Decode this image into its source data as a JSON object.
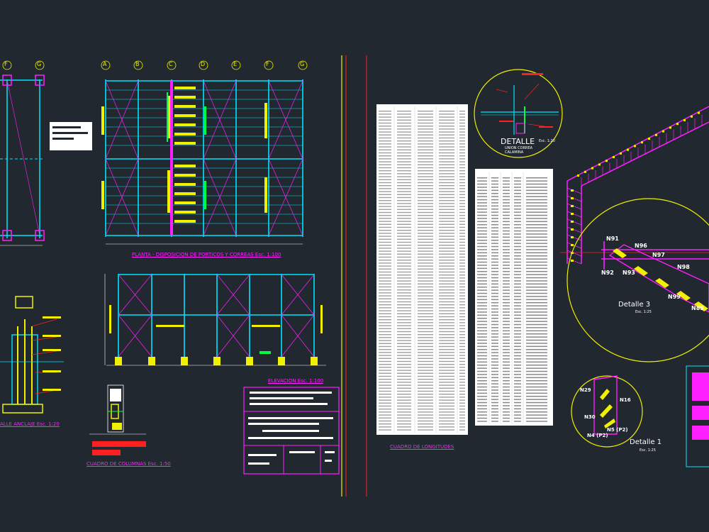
{
  "drawing": {
    "grid_labels_top": [
      "A",
      "B",
      "C",
      "D",
      "E",
      "F",
      "G"
    ],
    "grid_labels_left": [
      "F",
      "G"
    ],
    "plan_title": "PLANTA - DISPOSICION DE PORTICOS Y CORREAS   Esc. 1:100",
    "elevation_title": "ELEVACION    Esc. 1:100",
    "anchor_title": "ALLE ANCLAJE   Esc. 1:20",
    "columns_title": "CUADRO DE COLUMNAS   Esc. 1:50",
    "lengths_title": "CUADRO DE LONGITUDES",
    "detail_top": {
      "title": "DETALLE",
      "scale": "Esc. 1:20",
      "sub1": "UNION CORREA",
      "sub2": "CALAMINA"
    },
    "detail_3": {
      "title": "Detalle 3",
      "scale": "Esc. 1:25",
      "nodes": [
        "N91",
        "N92",
        "N93",
        "N96",
        "N97",
        "N98",
        "N99",
        "N89"
      ]
    },
    "detail_1": {
      "title": "Detalle 1",
      "scale": "Esc. 1:25",
      "nodes": [
        "N29",
        "N16",
        "N30",
        "N5 (P2)",
        "N4 (P2)"
      ]
    }
  },
  "colors": {
    "background": "#212830",
    "cyan": "#00e5ff",
    "magenta": "#ff20ff",
    "yellow": "#f0f000",
    "red": "#ff2020",
    "white": "#ffffff",
    "green": "#00ff40"
  }
}
